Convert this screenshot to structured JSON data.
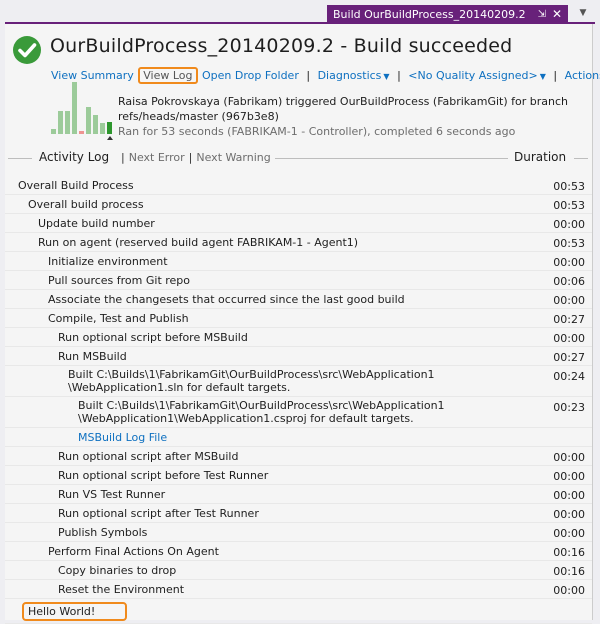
{
  "tab": {
    "title": "Build OurBuildProcess_20140209.2",
    "pin_icon": "pin-icon",
    "close_icon": "close-icon",
    "dropdown_icon": "chevron-down-icon"
  },
  "header": {
    "status_icon": "check-circle-icon",
    "title": "OurBuildProcess_20140209.2 - Build succeeded",
    "links": {
      "view_summary": "View Summary",
      "view_log": "View Log",
      "open_drop_folder": "Open Drop Folder",
      "diagnostics": "Diagnostics",
      "quality": "<No Quality Assigned>",
      "actions": "Actions"
    },
    "summary": {
      "line1": "Raisa Pokrovskaya (Fabrikam) triggered OurBuildProcess (FabrikamGit) for branch",
      "line2": "refs/heads/master (967b3e8)",
      "line3": "Ran for 53 seconds (FABRIKAM-1 - Controller), completed 6 seconds ago"
    },
    "history": [
      {
        "relative_height": 0.1,
        "status": "succeeded"
      },
      {
        "relative_height": 0.44,
        "status": "succeeded"
      },
      {
        "relative_height": 0.45,
        "status": "succeeded"
      },
      {
        "relative_height": 1.0,
        "status": "succeeded"
      },
      {
        "relative_height": 0.05,
        "status": "failed"
      },
      {
        "relative_height": 0.52,
        "status": "succeeded"
      },
      {
        "relative_height": 0.36,
        "status": "succeeded"
      },
      {
        "relative_height": 0.21,
        "status": "succeeded"
      },
      {
        "relative_height": 0.24,
        "status": "current"
      }
    ]
  },
  "activity": {
    "title": "Activity Log",
    "next_error": "Next Error",
    "next_warning": "Next Warning",
    "duration_header": "Duration",
    "rows": [
      {
        "label": "Overall Build Process",
        "time": "00:53",
        "level": 0
      },
      {
        "label": "Overall build process",
        "time": "00:53",
        "level": 1
      },
      {
        "label": "Update build number",
        "time": "00:00",
        "level": 2
      },
      {
        "label": "Run on agent (reserved build agent FABRIKAM-1 - Agent1)",
        "time": "00:53",
        "level": 2
      },
      {
        "label": "Initialize environment",
        "time": "00:00",
        "level": 3
      },
      {
        "label": "Pull sources from Git repo",
        "time": "00:06",
        "level": 3
      },
      {
        "label": "Associate the changesets that occurred since the last good build",
        "time": "00:00",
        "level": 3
      },
      {
        "label": "Compile, Test and Publish",
        "time": "00:27",
        "level": 3
      },
      {
        "label": "Run optional script before MSBuild",
        "time": "00:00",
        "level": 4
      },
      {
        "label": "Run MSBuild",
        "time": "00:27",
        "level": 4
      },
      {
        "label": "Built C:\\Builds\\1\\FabrikamGit\\OurBuildProcess\\src\\WebApplication1\n\\WebApplication1.sln for default targets.",
        "time": "00:24",
        "level": 5
      },
      {
        "label": "Built C:\\Builds\\1\\FabrikamGit\\OurBuildProcess\\src\\WebApplication1\n\\WebApplication1\\WebApplication1.csproj for default targets.",
        "time": "00:23",
        "level": 6
      },
      {
        "label": "MSBuild Log File",
        "time": "",
        "level": 6,
        "link": true
      },
      {
        "label": "Run optional script after MSBuild",
        "time": "00:00",
        "level": 4
      },
      {
        "label": "Run optional script before Test Runner",
        "time": "00:00",
        "level": 4
      },
      {
        "label": "Run VS Test Runner",
        "time": "00:00",
        "level": 4
      },
      {
        "label": "Run optional script after Test Runner",
        "time": "00:00",
        "level": 4
      },
      {
        "label": "Publish Symbols",
        "time": "00:00",
        "level": 4
      },
      {
        "label": "Perform Final Actions On Agent",
        "time": "00:16",
        "level": 3
      },
      {
        "label": "Copy binaries to drop",
        "time": "00:16",
        "level": 4
      },
      {
        "label": "Reset the Environment",
        "time": "00:00",
        "level": 4
      },
      {
        "label": "Hello World!",
        "time": "",
        "level": 1,
        "highlight": true
      }
    ]
  }
}
